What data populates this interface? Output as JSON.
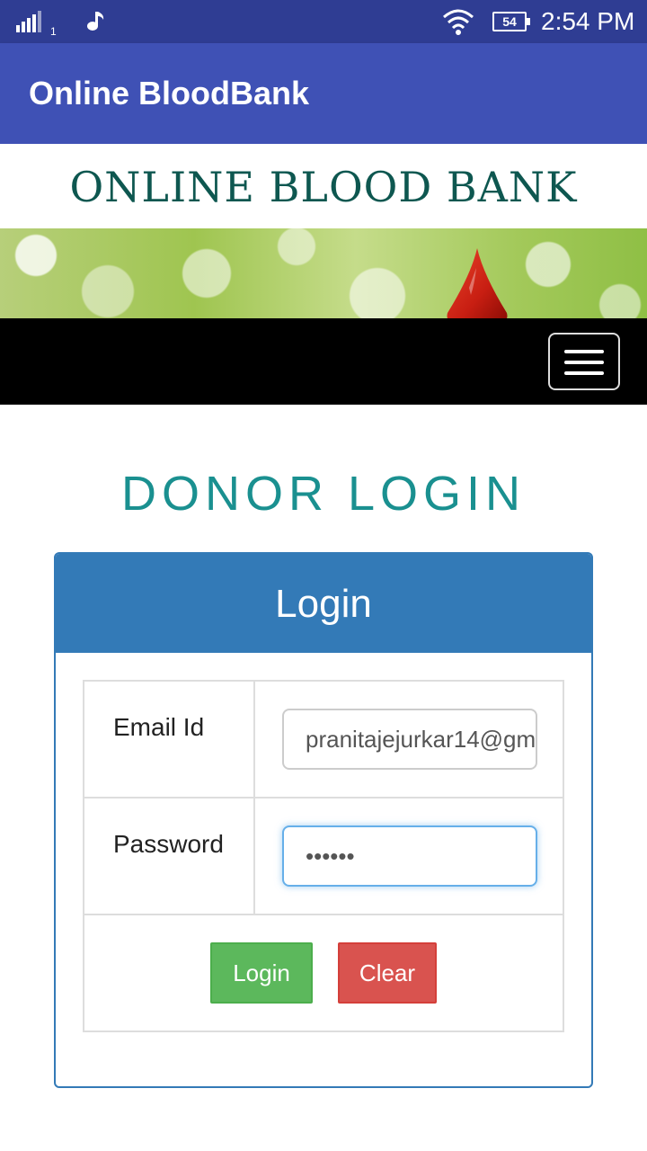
{
  "status_bar": {
    "sim_number": "1",
    "battery_level": "54",
    "time": "2:54 PM",
    "icons": [
      "signal-icon",
      "music-note-icon",
      "wifi-icon",
      "battery-icon"
    ]
  },
  "app_bar": {
    "title": "Online BloodBank"
  },
  "site": {
    "title": "ONLINE BLOOD BANK"
  },
  "navbar": {
    "menu_icon": "hamburger-menu-icon"
  },
  "page": {
    "heading": "DONOR LOGIN"
  },
  "login_panel": {
    "title": "Login",
    "email_label": "Email Id",
    "email_value": "pranitajejurkar14@gm",
    "password_label": "Password",
    "password_value": "••••••",
    "login_button": "Login",
    "clear_button": "Clear"
  },
  "colors": {
    "status_bar": "#2f3d93",
    "app_bar": "#3f51b5",
    "site_title": "#0e5750",
    "heading": "#1a9090",
    "panel_header": "#337ab7",
    "login_button": "#5cb85c",
    "clear_button": "#d9534f"
  }
}
